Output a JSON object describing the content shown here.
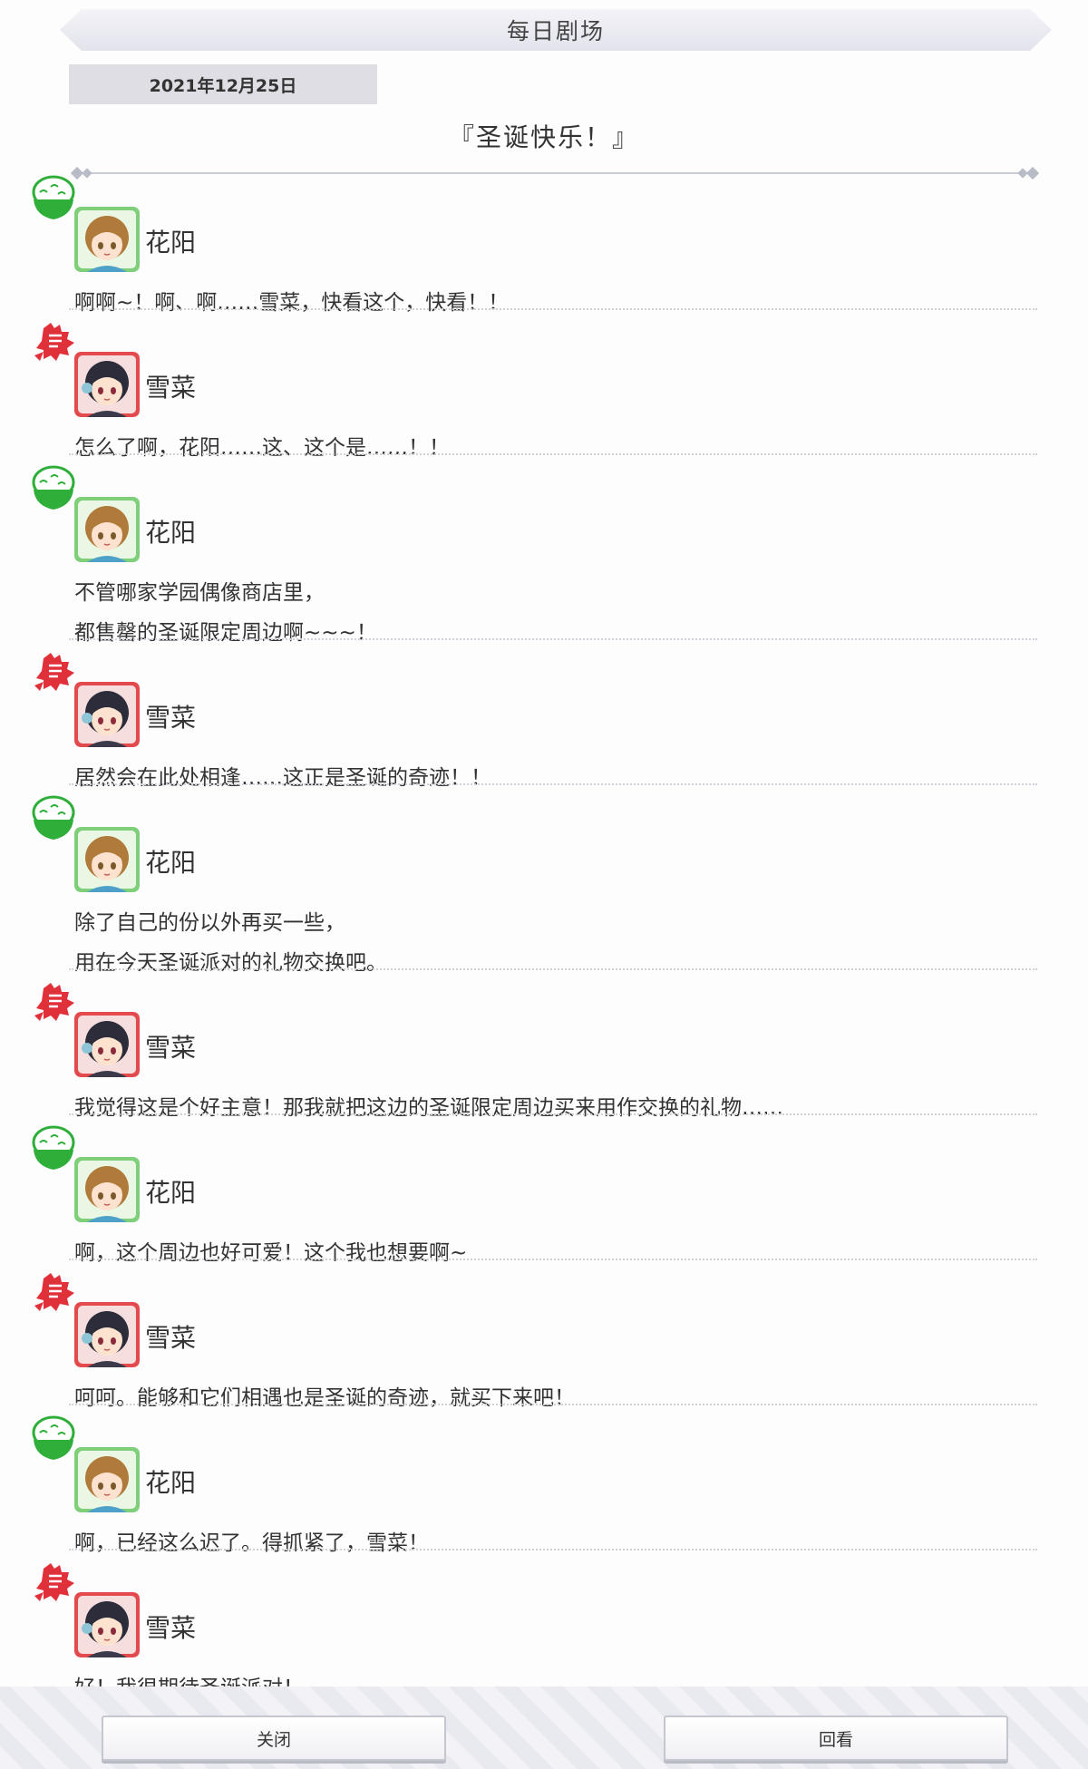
{
  "header": {
    "title": "每日剧场"
  },
  "date": "2021年12月25日",
  "story_title": "『圣诞快乐！』",
  "colors": {
    "hanayo_accent": "#2fae3a",
    "setsuna_accent": "#e0303a",
    "divider": "#c9ccd4"
  },
  "characters": {
    "hanayo": {
      "name": "花阳",
      "icon": "rice-bowl-icon"
    },
    "setsuna": {
      "name": "雪菜",
      "icon": "setsuna-emblem-icon"
    }
  },
  "dialogue": [
    {
      "speaker": "花阳",
      "lines": [
        "啊啊~！啊、啊……雪菜，快看这个，快看！！"
      ]
    },
    {
      "speaker": "雪菜",
      "lines": [
        "怎么了啊，花阳……这、这个是……！！"
      ]
    },
    {
      "speaker": "花阳",
      "lines": [
        "不管哪家学园偶像商店里，",
        "都售罄的圣诞限定周边啊~~~！"
      ]
    },
    {
      "speaker": "雪菜",
      "lines": [
        "居然会在此处相逢……这正是圣诞的奇迹！！"
      ]
    },
    {
      "speaker": "花阳",
      "lines": [
        "除了自己的份以外再买一些，",
        "用在今天圣诞派对的礼物交换吧。"
      ]
    },
    {
      "speaker": "雪菜",
      "lines": [
        "我觉得这是个好主意！那我就把这边的圣诞限定周边买来用作交换的礼物……"
      ]
    },
    {
      "speaker": "花阳",
      "lines": [
        "啊，这个周边也好可爱！这个我也想要啊~"
      ]
    },
    {
      "speaker": "雪菜",
      "lines": [
        "呵呵。能够和它们相遇也是圣诞的奇迹，就买下来吧！"
      ]
    },
    {
      "speaker": "花阳",
      "lines": [
        "啊，已经这么迟了。得抓紧了，雪菜！"
      ]
    },
    {
      "speaker": "雪菜",
      "lines": [
        "好！我很期待圣诞派对！"
      ]
    }
  ],
  "footer": {
    "close_label": "关闭",
    "review_label": "回看"
  }
}
